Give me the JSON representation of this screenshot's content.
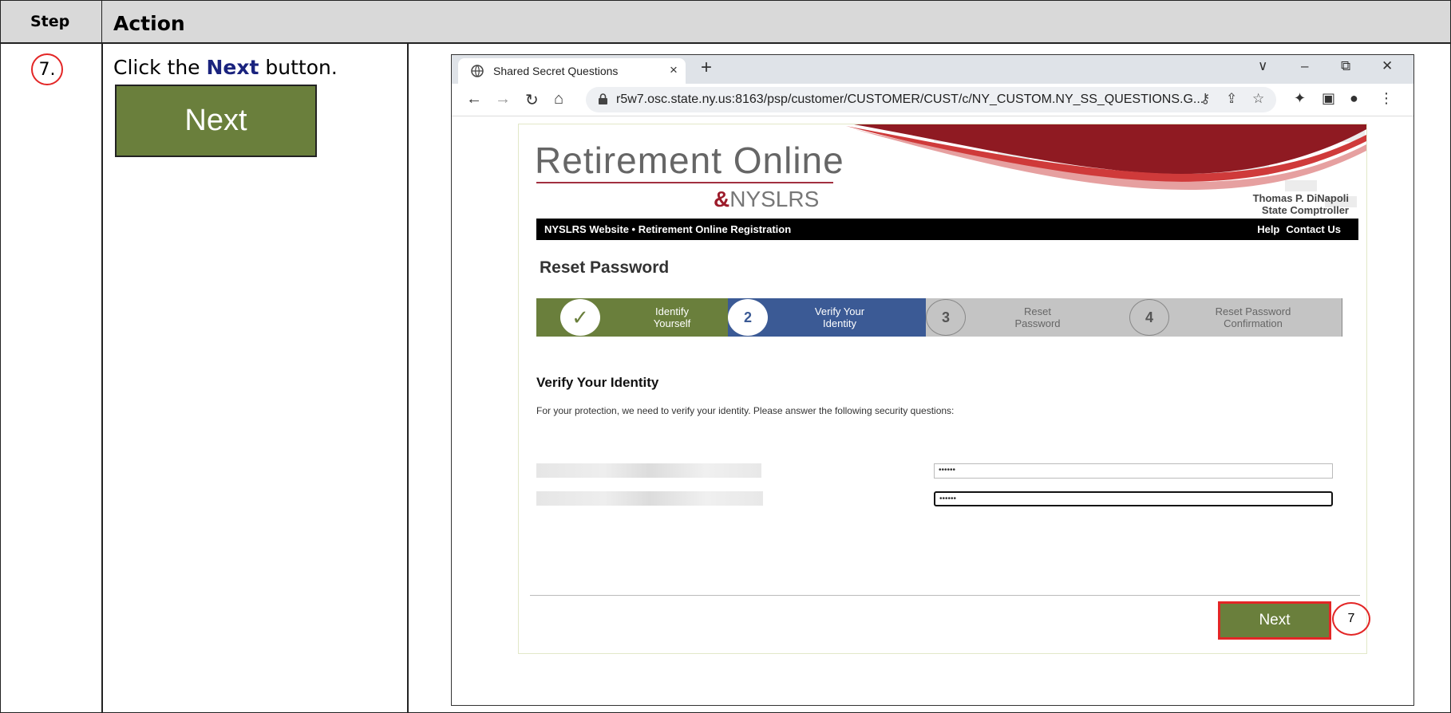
{
  "table": {
    "header_step": "Step",
    "header_action": "Action",
    "step_number": "7.",
    "instruction_prefix": "Click the ",
    "instruction_bold": "Next",
    "instruction_suffix": " button.",
    "sample_button_label": "Next"
  },
  "browser": {
    "tab_title": "Shared Secret Questions",
    "tab_close": "×",
    "new_tab": "+",
    "url": "r5w7.osc.state.ny.us:8163/psp/customer/CUSTOMER/CUST/c/NY_CUSTOM.NY_SS_QUESTIONS.G..."
  },
  "site": {
    "logo_title": "Retirement Online",
    "logo_sub": "NYSLRS",
    "comptroller_name": "Thomas P. DiNapoli",
    "comptroller_title": "State Comptroller",
    "nav_left": "NYSLRS Website • Retirement Online Registration",
    "nav_help": "Help",
    "nav_contact": "Contact Us",
    "page_title": "Reset Password"
  },
  "stepper": {
    "steps": [
      {
        "number": "✓",
        "label_line1": "Identify",
        "label_line2": "Yourself",
        "state": "done"
      },
      {
        "number": "2",
        "label_line1": "Verify Your",
        "label_line2": "Identity",
        "state": "current"
      },
      {
        "number": "3",
        "label_line1": "Reset",
        "label_line2": "Password",
        "state": "todo"
      },
      {
        "number": "4",
        "label_line1": "Reset Password",
        "label_line2": "Confirmation",
        "state": "todo"
      }
    ]
  },
  "form": {
    "section_title": "Verify Your Identity",
    "description": "For your protection, we need to verify your identity. Please answer the following security questions:",
    "answer1_value": "••••••",
    "answer2_value": "••••••",
    "next_label": "Next"
  },
  "callout_number": "7",
  "colors": {
    "green": "#6a7f3c",
    "blue": "#3b5a95",
    "gray": "#c4c4c4",
    "highlight_red": "#e32626",
    "header_gray": "#d9d9d9"
  }
}
